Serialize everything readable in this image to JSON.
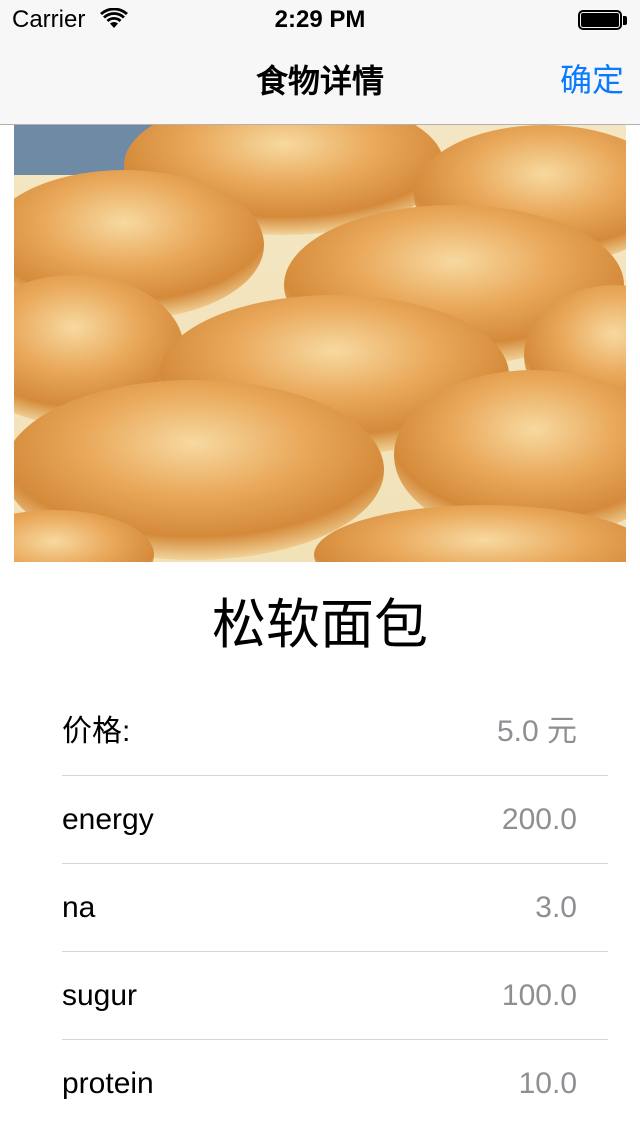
{
  "status_bar": {
    "carrier": "Carrier",
    "time": "2:29 PM"
  },
  "nav": {
    "title": "食物详情",
    "confirm_label": "确定",
    "accent_color": "#0a7aff"
  },
  "food": {
    "image_icon": "bread-photo",
    "name": "松软面包"
  },
  "nutrition": [
    {
      "label": "价格:",
      "value": "5.0 元"
    },
    {
      "label": "energy",
      "value": "200.0"
    },
    {
      "label": "na",
      "value": "3.0"
    },
    {
      "label": "sugur",
      "value": "100.0"
    },
    {
      "label": "protein",
      "value": "10.0"
    }
  ]
}
